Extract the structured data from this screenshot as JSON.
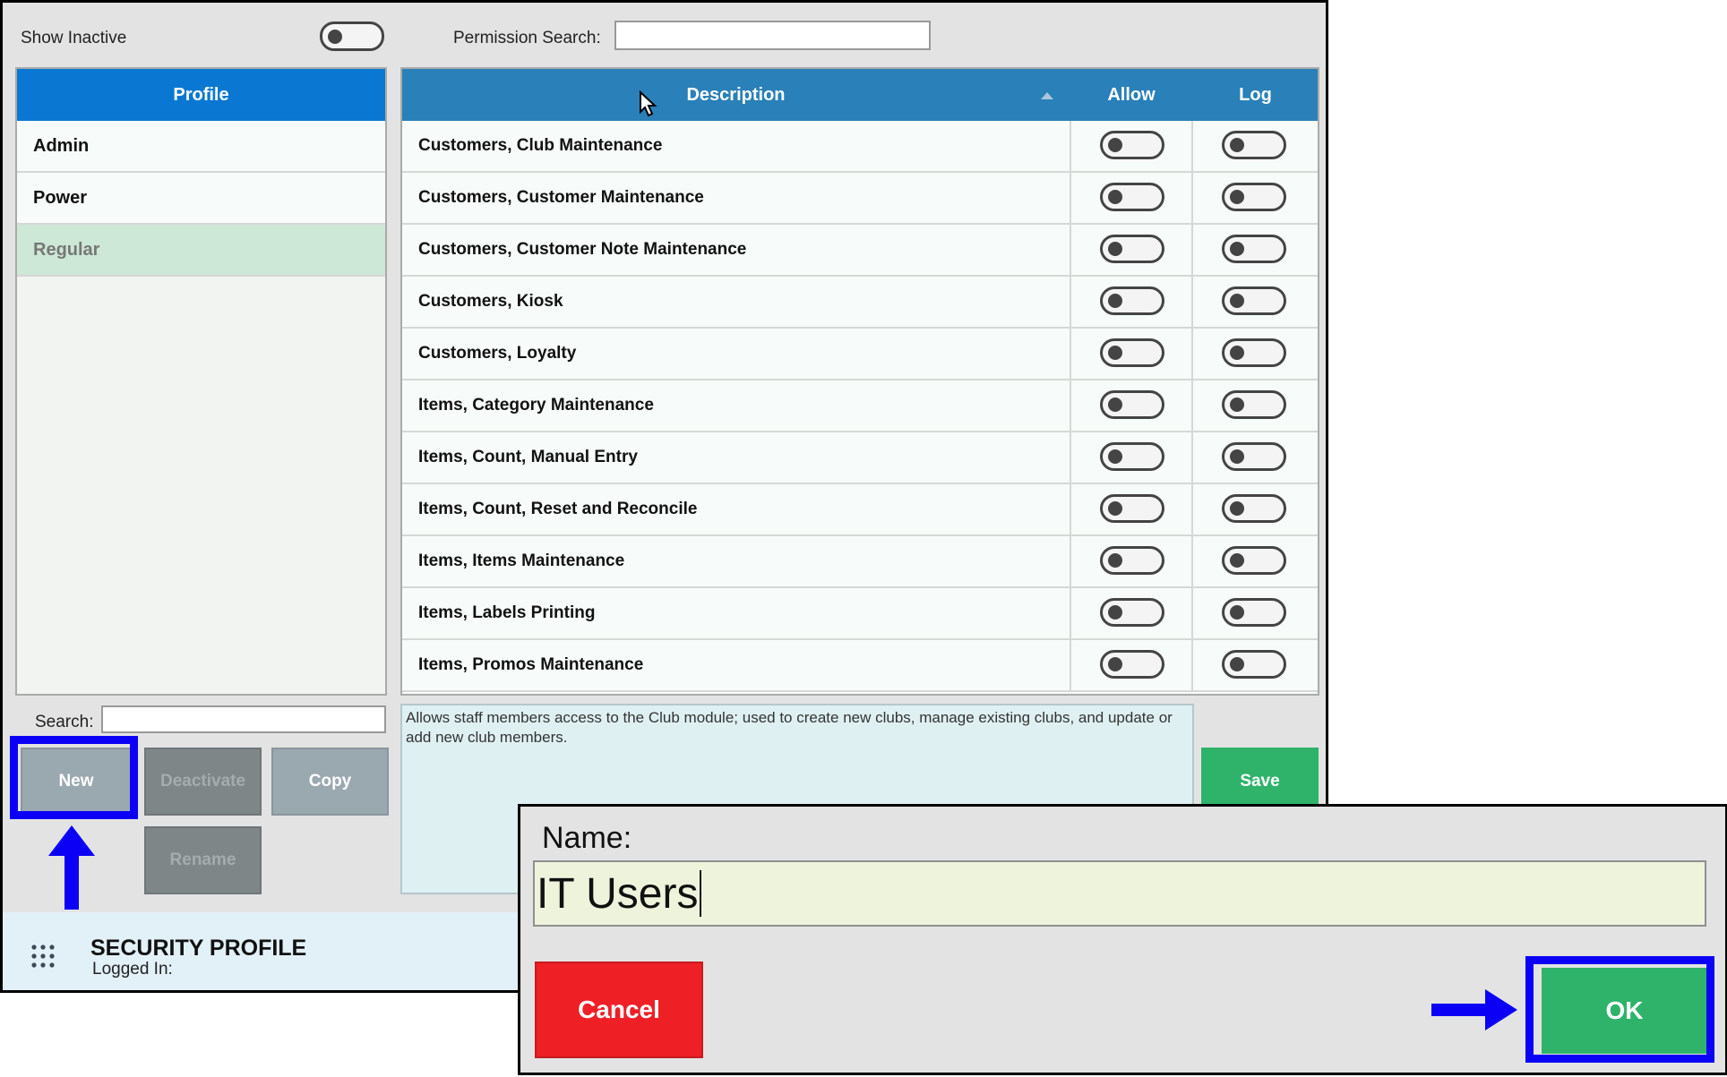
{
  "top_bar": {
    "show_inactive_label": "Show Inactive",
    "permission_search_label": "Permission Search:",
    "permission_search_value": ""
  },
  "profiles": {
    "header": "Profile",
    "items": [
      {
        "label": "Admin"
      },
      {
        "label": "Power"
      },
      {
        "label": "Regular"
      }
    ],
    "selected": "Regular"
  },
  "permissions": {
    "columns": {
      "description": "Description",
      "allow": "Allow",
      "log": "Log"
    },
    "rows": [
      {
        "description": "Customers, Club Maintenance",
        "allow": false,
        "log": false
      },
      {
        "description": "Customers, Customer Maintenance",
        "allow": false,
        "log": false
      },
      {
        "description": "Customers, Customer Note Maintenance",
        "allow": false,
        "log": false
      },
      {
        "description": "Customers, Kiosk",
        "allow": false,
        "log": false
      },
      {
        "description": "Customers, Loyalty",
        "allow": false,
        "log": false
      },
      {
        "description": "Items, Category Maintenance",
        "allow": false,
        "log": false
      },
      {
        "description": "Items, Count, Manual Entry",
        "allow": false,
        "log": false
      },
      {
        "description": "Items, Count, Reset and Reconcile",
        "allow": false,
        "log": false
      },
      {
        "description": "Items, Items Maintenance",
        "allow": false,
        "log": false
      },
      {
        "description": "Items, Labels Printing",
        "allow": false,
        "log": false
      },
      {
        "description": "Items, Promos Maintenance",
        "allow": false,
        "log": false
      }
    ]
  },
  "description_text": "Allows staff members access to the Club module; used to create new clubs,  manage existing clubs, and update or add new club members.",
  "left_controls": {
    "search_label": "Search:",
    "search_value": "",
    "new_label": "New",
    "deactivate_label": "Deactivate",
    "copy_label": "Copy",
    "rename_label": "Rename"
  },
  "save_label": "Save",
  "footer": {
    "title": "SECURITY PROFILE",
    "logged_in_label": "Logged In:"
  },
  "dialog": {
    "name_label": "Name:",
    "name_value": "IT Users",
    "cancel_label": "Cancel",
    "ok_label": "OK"
  },
  "colors": {
    "profile_header": "#0a78d2",
    "table_header": "#2a80b8",
    "selected_row": "#cde8d6",
    "save_green": "#2fb36b",
    "cancel_red": "#ee2026",
    "annotation_blue": "#0b00f5"
  },
  "icons": {
    "menu": "grid-dots-icon",
    "sort": "sort-ascending-icon",
    "pointer": "mouse-pointer-icon",
    "annotation_arrows": [
      "arrow-up-icon",
      "arrow-right-icon"
    ]
  }
}
